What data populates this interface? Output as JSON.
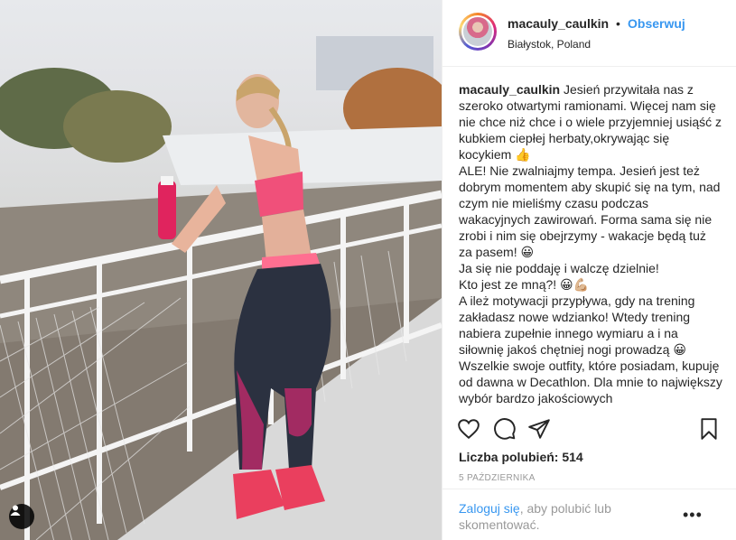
{
  "post": {
    "username": "macauly_caulkin",
    "separator": "•",
    "follow_label": "Obserwuj",
    "location": "Białystok, Poland",
    "caption_author": "macauly_caulkin",
    "caption_lines": [
      "Jesień przywitała nas z szeroko otwartymi ramionami. Więcej nam się nie chce niż chce i o wiele przyjemniej usiąść z kubkiem ciepłej herbaty,okrywając się kocykiem 👍",
      "ALE! Nie zwalniajmy tempa. Jesień jest też dobrym momentem aby skupić się na tym, nad czym nie mieliśmy czasu podczas wakacyjnych zawirowań. Forma sama się nie zrobi i nim się obejrzymy - wakacje będą tuż za pasem! 😀",
      "Ja się nie poddaję i walczę dzielnie!",
      "Kto jest ze mną?! 😀💪🏼",
      "A ileż motywacji przypływa, gdy na trening zakładasz nowe wdzianko! Wtedy trening nabiera zupełnie innego wymiaru a i na siłownię jakoś chętniej nogi prowadzą 😀",
      "Wszelkie swoje outfity, które posiadam, kupuję od dawna w Decathlon. Dla mnie to największy wybór bardzo jakościowych"
    ],
    "likes_label": "Liczba polubień: 514",
    "date": "5 PAŹDZIERNIKA",
    "login_link": "Zaloguj się",
    "login_rest": ", aby polubić lub skomentować.",
    "more_label": "•••"
  },
  "icons": {
    "like": "heart-icon",
    "comment": "comment-bubble-icon",
    "share": "share-paper-plane-icon",
    "save": "bookmark-icon",
    "tagged": "tagged-user-icon"
  },
  "colors": {
    "accent": "#3897f0",
    "text": "#262626",
    "muted": "#999999",
    "border": "#efefef"
  }
}
